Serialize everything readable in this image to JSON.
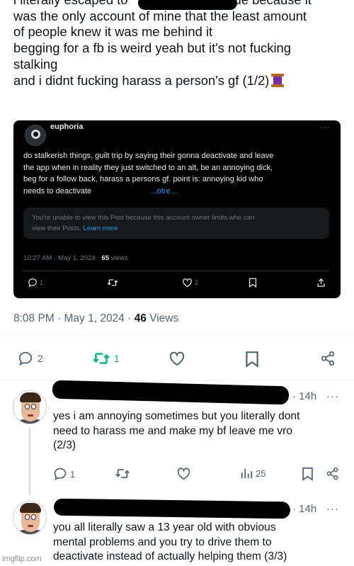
{
  "post": {
    "lines": [
      "i literally escaped to",
      "de because it",
      "was the only account of mine that the least amount",
      "of people knew it was me behind it",
      "begging for a fb is weird yeah but it's not fucking",
      "stalking",
      "and i didnt fucking harass a person's gf (1/2)"
    ],
    "emoji_icon": "thread-spool-icon"
  },
  "quoted": {
    "name": "euphoria",
    "more": "···",
    "body_lines": [
      "do stalkerish things, guilt trip by saying their gonna deactivate and leave",
      "the app when in reality they just switched to an alt, be an annoying dick,",
      "beg for a follow back, harass a persons gf. point is: annoying kid who",
      "needs to deactivate"
    ],
    "show_more": "...otre...",
    "notice_line1": "You're unable to view this Post because this account owner limits who can",
    "notice_line2_prefix": "view their Posts.",
    "notice_link": "Learn more",
    "time": "10:27 AM · May 1, 2024 ·",
    "views_count": "65",
    "views_label": "views",
    "actions": {
      "reply": "1",
      "retweet": "",
      "like": "2"
    }
  },
  "meta": {
    "time": "8:08 PM · May 1, 2024 ·",
    "views_count": "46",
    "views_label": "Views"
  },
  "actions": {
    "reply": "2",
    "retweet": "1",
    "like": ""
  },
  "replies": [
    {
      "time": "· 14h",
      "more": "···",
      "lines": [
        "yes i am annoying sometimes but you literally dont",
        "need to harass me and make my bf leave me vro",
        "(2/3)"
      ],
      "actions": {
        "reply": "1",
        "retweet": "",
        "like": "",
        "views": "25"
      }
    },
    {
      "time": "· 14h",
      "more": "···",
      "lines": [
        "you all literally saw a 13 year old with obvious",
        "mental problems and you try to drive them to",
        "deactivate instead of actually helping them (3/3)"
      ]
    }
  ],
  "watermark": "imgflip.com",
  "colors": {
    "retweet_active": "#00ba7c",
    "link": "#1d9bf0",
    "muted": "#536471"
  }
}
